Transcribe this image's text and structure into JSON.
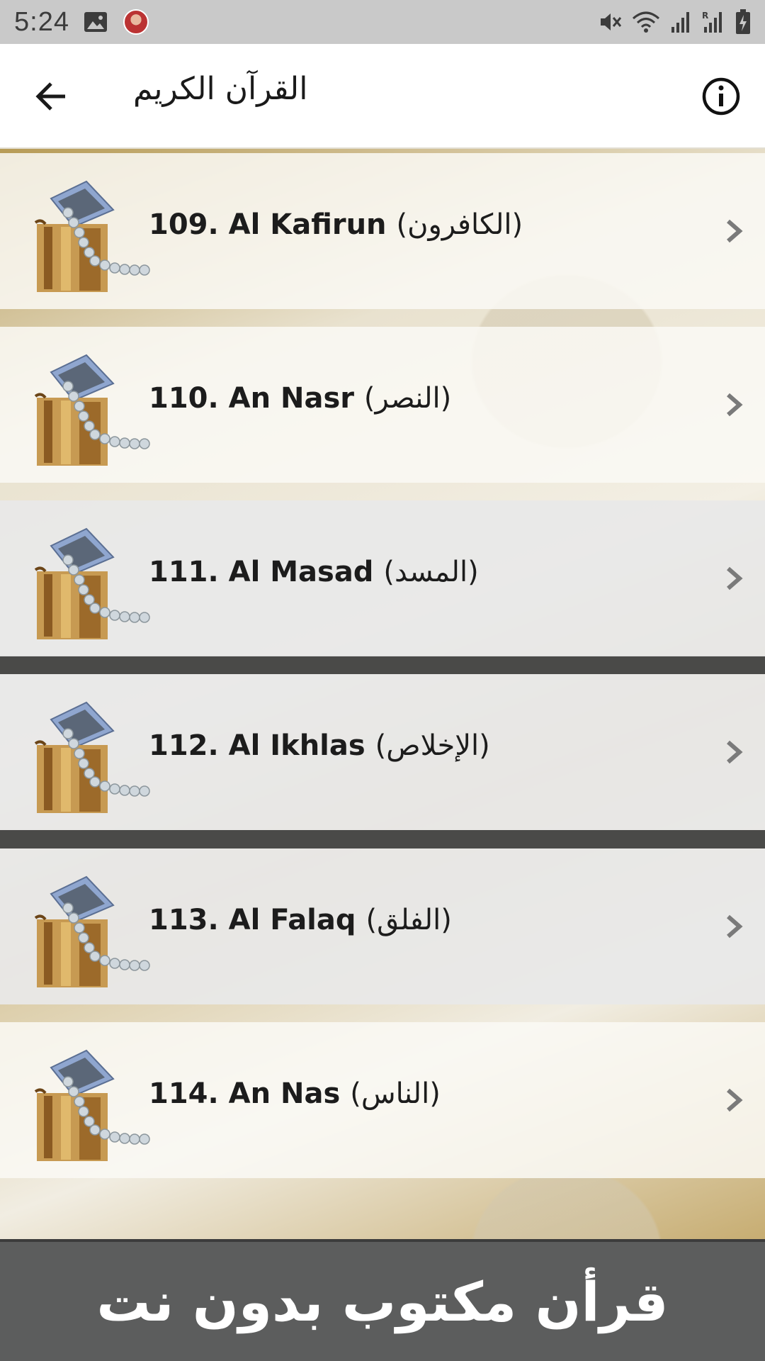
{
  "status_bar": {
    "time": "5:24",
    "left_icons": [
      "image-icon",
      "avatar-icon"
    ],
    "right_icons": [
      "mute-icon",
      "wifi-icon",
      "signal-icon",
      "roaming-signal-icon",
      "battery-charging-icon"
    ]
  },
  "app_bar": {
    "title": "القرآن الكريم",
    "back_icon": "arrow-left-icon",
    "info_icon": "info-icon"
  },
  "surahs": [
    {
      "label": "109. Al Kafirun",
      "arabic": "(الكافرون)",
      "style": "light"
    },
    {
      "label": "110. An Nasr",
      "arabic": "(النصر)",
      "style": "light"
    },
    {
      "label": "111. Al Masad",
      "arabic": "(المسد)",
      "style": "grey"
    },
    {
      "label": "112. Al Ikhlas",
      "arabic": "(الإخلاص)",
      "style": "grey"
    },
    {
      "label": "113. Al Falaq",
      "arabic": "(الفلق)",
      "style": "grey"
    },
    {
      "label": "114. An Nas",
      "arabic": "(الناس)",
      "style": "light"
    }
  ],
  "footer": {
    "text": "قرأن مكتوب بدون نت"
  }
}
